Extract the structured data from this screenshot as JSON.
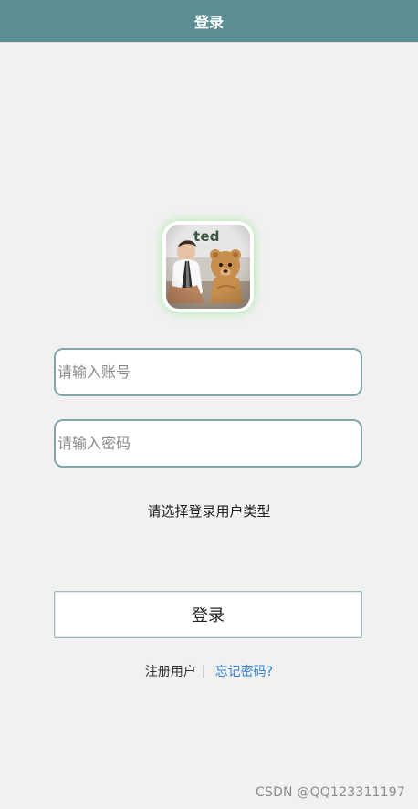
{
  "header": {
    "title": "登录"
  },
  "avatar": {
    "icon": "ted-movie-avatar-icon",
    "logo_text": "ted"
  },
  "inputs": {
    "account": {
      "placeholder": "请输入账号",
      "value": ""
    },
    "password": {
      "placeholder": "请输入密码",
      "value": ""
    }
  },
  "user_type": {
    "label": "请选择登录用户类型"
  },
  "actions": {
    "login_label": "登录"
  },
  "links": {
    "register": "注册用户",
    "separator": "|",
    "forgot": "忘记密码?"
  },
  "watermark": {
    "text": "CSDN @QQ123311197"
  },
  "colors": {
    "header_bg": "#5b8f93",
    "page_bg": "#f1f1f1",
    "input_border": "#7fa6ad",
    "link_blue": "#2f7fd6",
    "avatar_glow": "#64dc5a"
  }
}
